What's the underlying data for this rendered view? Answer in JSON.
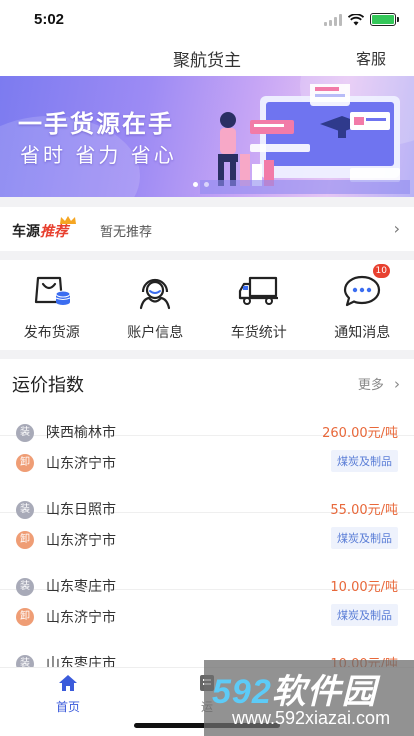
{
  "status_bar": {
    "time": "5:02"
  },
  "navbar": {
    "title": "聚航货主",
    "service": "客服"
  },
  "banner": {
    "headline": "一手货源在手",
    "subline": "省时 省力 省心"
  },
  "recommend": {
    "brand_prefix": "车源",
    "brand_highlight": "推荐",
    "text": "暂无推荐"
  },
  "quick_entries": [
    {
      "label": "发布货源",
      "icon": "cart-coins-icon"
    },
    {
      "label": "账户信息",
      "icon": "person-headset-icon"
    },
    {
      "label": "车货统计",
      "icon": "truck-icon"
    },
    {
      "label": "通知消息",
      "icon": "chat-bubble-icon",
      "badge": "10"
    }
  ],
  "price_index": {
    "title": "运价指数",
    "more": "更多",
    "load_tag": "装",
    "unload_tag": "卸",
    "routes": [
      {
        "from": "陕西榆林市",
        "to": "山东济宁市",
        "price": "260.00元/吨",
        "category": "煤炭及制品"
      },
      {
        "from": "山东日照市",
        "to": "山东济宁市",
        "price": "55.00元/吨",
        "category": "煤炭及制品"
      },
      {
        "from": "山东枣庄市",
        "to": "山东济宁市",
        "price": "10.00元/吨",
        "category": "煤炭及制品"
      },
      {
        "from": "山东枣庄市",
        "to": "",
        "price": "10.00元/吨",
        "category": ""
      }
    ]
  },
  "tabbar": {
    "home": "首页",
    "ship": "运"
  },
  "watermark": {
    "brand_num": "592",
    "brand_text": "软件园",
    "url": "www.592xiazai.com"
  },
  "colors": {
    "accent": "#3b5bdb",
    "price": "#e8683a",
    "badge": "#e8402f"
  }
}
